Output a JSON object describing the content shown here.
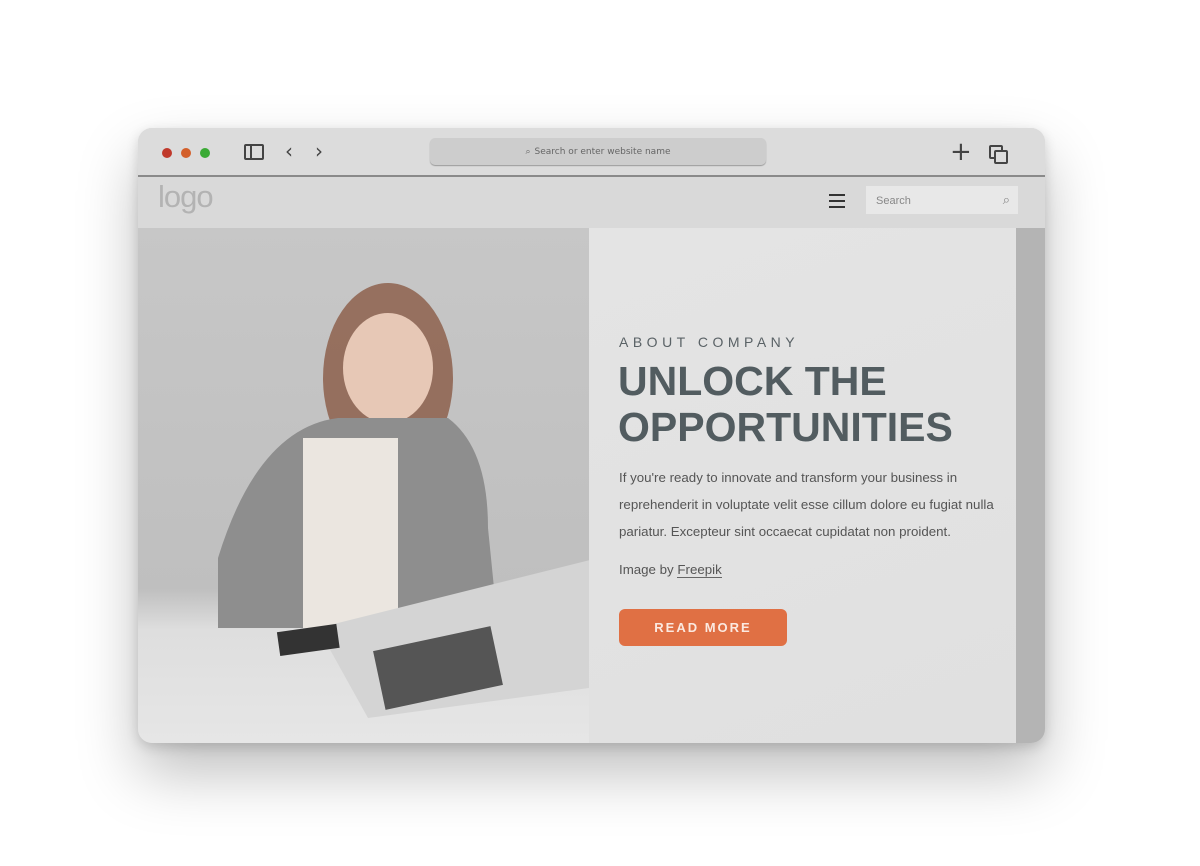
{
  "browser": {
    "address_placeholder": "Search or enter website name",
    "traffic_colors": [
      "#c0392b",
      "#d35f2a",
      "#3aaa35"
    ]
  },
  "site": {
    "logo": "logo",
    "search_placeholder": "Search"
  },
  "hero": {
    "eyebrow": "ABOUT COMPANY",
    "title_line1": "UNLOCK THE",
    "title_line2": "OPPORTUNITIES",
    "body": "If you're ready to innovate and transform your business in reprehenderit in voluptate velit esse cillum dolore eu fugiat nulla pariatur. Excepteur sint occaecat cupidatat non proident.",
    "credit_prefix": "Image by",
    "credit_link": "Freepik",
    "cta": "READ MORE",
    "accent": "#e07044"
  }
}
